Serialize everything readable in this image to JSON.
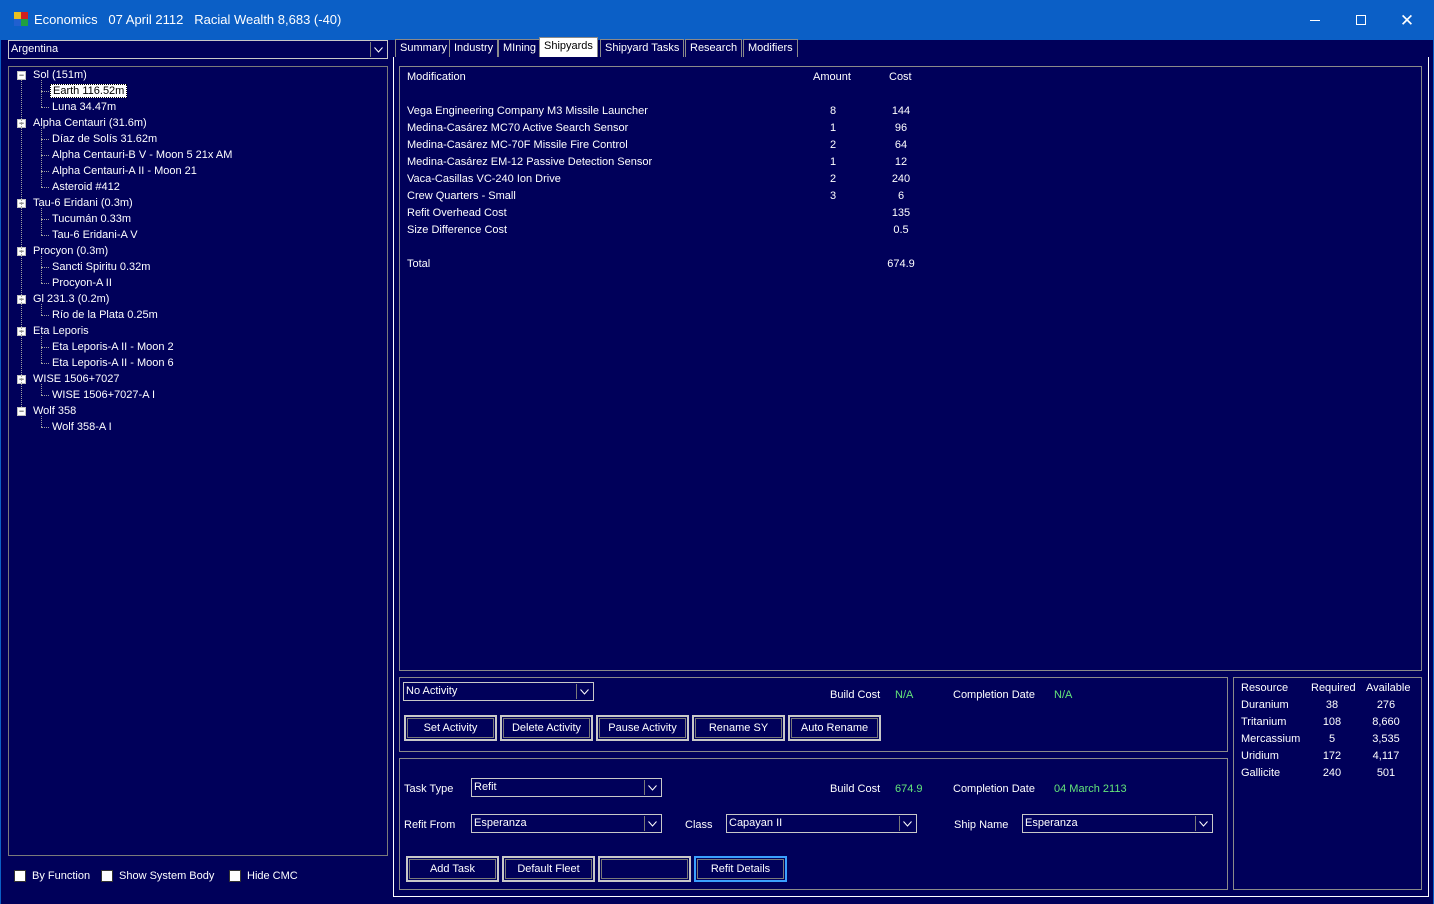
{
  "window": {
    "app_name": "Economics",
    "date": "07 April 2112",
    "wealth": "Racial Wealth 8,683 (-40)",
    "colors": {
      "titlebar": "#0b5fc6",
      "background": "#00005a",
      "accent_green": "#64e67a"
    }
  },
  "empire_select": {
    "value": "Argentina"
  },
  "tree": [
    {
      "label": "Sol  (151m)",
      "level": 0
    },
    {
      "label": "Earth  116.52m",
      "level": 1,
      "selected": true
    },
    {
      "label": "Luna  34.47m",
      "level": 1
    },
    {
      "label": "Alpha Centauri  (31.6m)",
      "level": 0
    },
    {
      "label": "Díaz de Solís  31.62m",
      "level": 1
    },
    {
      "label": "Alpha Centauri-B V - Moon 5  21x AM",
      "level": 1
    },
    {
      "label": "Alpha Centauri-A II - Moon 21",
      "level": 1
    },
    {
      "label": "Asteroid #412",
      "level": 1
    },
    {
      "label": "Tau-6 Eridani  (0.3m)",
      "level": 0
    },
    {
      "label": "Tucumán  0.33m",
      "level": 1
    },
    {
      "label": "Tau-6 Eridani-A V",
      "level": 1
    },
    {
      "label": "Procyon  (0.3m)",
      "level": 0
    },
    {
      "label": "Sancti Spiritu  0.32m",
      "level": 1
    },
    {
      "label": "Procyon-A II",
      "level": 1
    },
    {
      "label": "Gl 231.3  (0.2m)",
      "level": 0
    },
    {
      "label": "Río de la Plata  0.25m",
      "level": 1
    },
    {
      "label": "Eta Leporis",
      "level": 0
    },
    {
      "label": "Eta Leporis-A II - Moon 2",
      "level": 1
    },
    {
      "label": "Eta Leporis-A II - Moon 6",
      "level": 1
    },
    {
      "label": "WISE 1506+7027",
      "level": 0
    },
    {
      "label": "WISE 1506+7027-A I",
      "level": 1
    },
    {
      "label": "Wolf 358",
      "level": 0
    },
    {
      "label": "Wolf 358-A I",
      "level": 1
    }
  ],
  "checkboxes": {
    "by_function": "By Function",
    "show_system_body": "Show System Body",
    "hide_cmc": "Hide CMC"
  },
  "tabs": [
    "Summary",
    "Industry",
    "MIning",
    "Shipyards",
    "Shipyard Tasks",
    "Research",
    "Modifiers"
  ],
  "active_tab": "Shipyards",
  "mod_table": {
    "headers": {
      "modification": "Modification",
      "amount": "Amount",
      "cost": "Cost"
    },
    "rows": [
      {
        "name": "Vega Engineering Company M3 Missile Launcher",
        "amount": "8",
        "cost": "144"
      },
      {
        "name": "Medina-Casárez MC70 Active Search Sensor",
        "amount": "1",
        "cost": "96"
      },
      {
        "name": "Medina-Casárez MC-70F Missile Fire Control",
        "amount": "2",
        "cost": "64"
      },
      {
        "name": "Medina-Casárez EM-12 Passive Detection Sensor",
        "amount": "1",
        "cost": "12"
      },
      {
        "name": "Vaca-Casillas VC-240 Ion Drive",
        "amount": "2",
        "cost": "240"
      },
      {
        "name": "Crew Quarters - Small",
        "amount": "3",
        "cost": "6"
      },
      {
        "name": "Refit Overhead Cost",
        "amount": "",
        "cost": "135"
      },
      {
        "name": "Size Difference Cost",
        "amount": "",
        "cost": "0.5"
      }
    ],
    "total_label": "Total",
    "total_value": "674.9"
  },
  "activity": {
    "select_value": "No Activity",
    "build_cost_label": "Build Cost",
    "build_cost_value": "N/A",
    "completion_label": "Completion Date",
    "completion_value": "N/A",
    "buttons": {
      "set": "Set Activity",
      "delete": "Delete Activity",
      "pause": "Pause Activity",
      "rename": "Rename SY",
      "auto_rename": "Auto Rename"
    }
  },
  "task": {
    "task_type_label": "Task Type",
    "task_type_value": "Refit",
    "build_cost_label": "Build Cost",
    "build_cost_value": "674.9",
    "completion_label": "Completion Date",
    "completion_value": "04 March 2113",
    "refit_from_label": "Refit From",
    "refit_from_value": "Esperanza",
    "class_label": "Class",
    "class_value": "Capayan II",
    "ship_name_label": "Ship Name",
    "ship_name_value": "Esperanza",
    "buttons": {
      "add_task": "Add Task",
      "default_fleet": "Default Fleet",
      "blank": "",
      "refit_details": "Refit Details"
    }
  },
  "resources": {
    "headers": {
      "resource": "Resource",
      "required": "Required",
      "available": "Available"
    },
    "rows": [
      {
        "name": "Duranium",
        "required": "38",
        "available": "276"
      },
      {
        "name": "Tritanium",
        "required": "108",
        "available": "8,660"
      },
      {
        "name": "Mercassium",
        "required": "5",
        "available": "3,535"
      },
      {
        "name": "Uridium",
        "required": "172",
        "available": "4,117"
      },
      {
        "name": "Gallicite",
        "required": "240",
        "available": "501"
      }
    ]
  }
}
